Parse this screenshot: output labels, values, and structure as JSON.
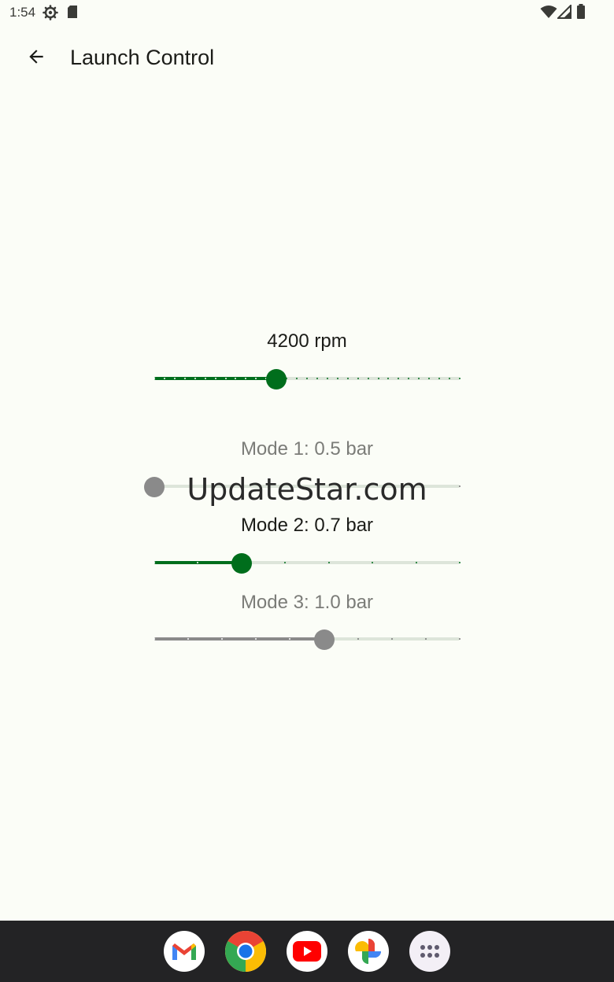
{
  "status_bar": {
    "time": "1:54",
    "icons": [
      "settings-gear-icon",
      "sd-card-icon",
      "wifi-icon",
      "cell-signal-icon",
      "battery-icon"
    ]
  },
  "app_bar": {
    "back_icon": "arrow-back-icon",
    "title": "Launch Control"
  },
  "colors": {
    "accent": "#006e1c",
    "accent_track_inactive": "#dde5da",
    "disabled": "#8a8a8a",
    "background": "#fbfdf7",
    "dock": "#232325"
  },
  "sliders": [
    {
      "id": "rpm",
      "label": "4200 rpm",
      "enabled": true,
      "value_fraction": 0.4,
      "ticks": 31
    },
    {
      "id": "mode1",
      "label": "Mode 1: 0.5 bar",
      "enabled": false,
      "value_fraction": 0.0,
      "ticks": 2
    },
    {
      "id": "mode2",
      "label": "Mode 2: 0.7 bar",
      "enabled": true,
      "value_fraction": 0.286,
      "ticks": 8
    },
    {
      "id": "mode3",
      "label": "Mode 3: 1.0 bar",
      "enabled": false,
      "value_fraction": 0.556,
      "ticks": 10
    }
  ],
  "watermark": "UpdateStar.com",
  "dock": {
    "apps": [
      "gmail-icon",
      "chrome-icon",
      "youtube-icon",
      "photos-icon",
      "app-drawer-icon"
    ]
  }
}
